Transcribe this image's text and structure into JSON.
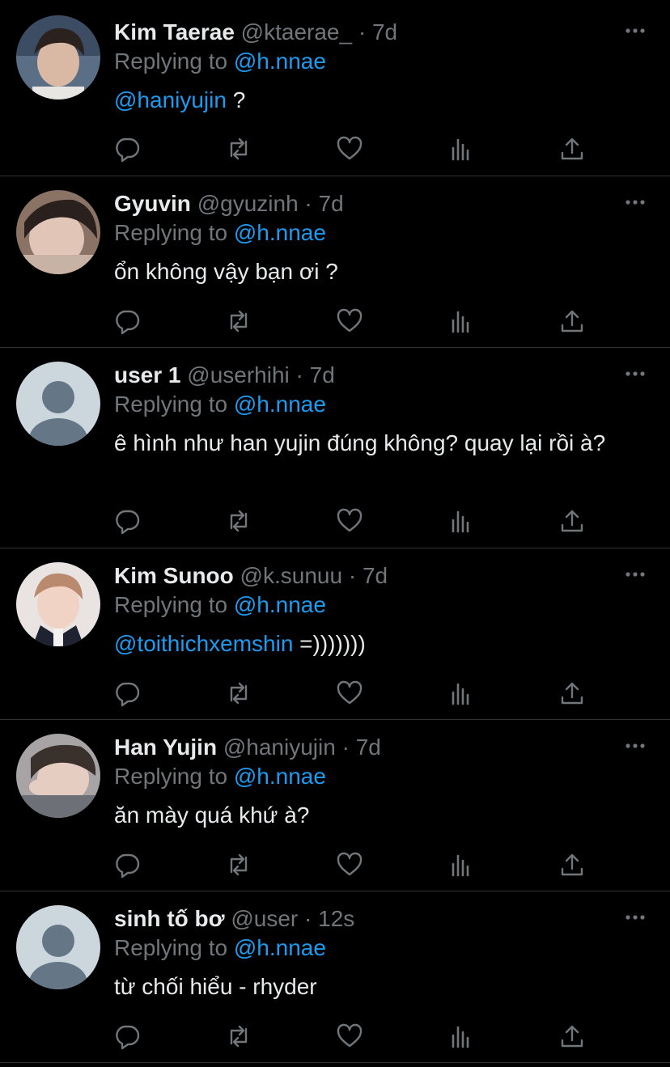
{
  "replies": [
    {
      "name": "Kim Taerae",
      "handle": "@ktaerae_",
      "dot": "·",
      "time": "7d",
      "replying_prefix": "Replying to",
      "replying_to": "@h.nnae",
      "body_mention": "@haniyujin",
      "body_text": " ?",
      "avatar": "photo"
    },
    {
      "name": "Gyuvin",
      "handle": "@gyuzinh",
      "dot": "·",
      "time": "7d",
      "replying_prefix": "Replying to",
      "replying_to": "@h.nnae",
      "body_mention": "",
      "body_text": "ổn không vậy bạn ơi ?",
      "avatar": "photo"
    },
    {
      "name": "user 1",
      "handle": "@userhihi",
      "dot": "·",
      "time": "7d",
      "replying_prefix": "Replying to",
      "replying_to": "@h.nnae",
      "body_mention": "",
      "body_text": "ê hình như han yujin đúng không? quay lại rồi à?",
      "avatar": "default"
    },
    {
      "name": "Kim Sunoo",
      "handle": "@k.sunuu",
      "dot": "·",
      "time": "7d",
      "replying_prefix": "Replying to",
      "replying_to": "@h.nnae",
      "body_mention": "@toithichxemshin",
      "body_text": " =)))))))",
      "avatar": "photo"
    },
    {
      "name": "Han Yujin",
      "handle": "@haniyujin",
      "dot": "·",
      "time": "7d",
      "replying_prefix": "Replying to",
      "replying_to": "@h.nnae",
      "body_mention": "",
      "body_text": "ăn mày quá khứ à?",
      "avatar": "photo"
    },
    {
      "name": "sinh tố bơ",
      "handle": "@user",
      "dot": "·",
      "time": "12s",
      "replying_prefix": "Replying to",
      "replying_to": "@h.nnae",
      "body_mention": "",
      "body_text": "từ chối hiểu - rhyder",
      "avatar": "default"
    }
  ],
  "actions": [
    "reply-icon",
    "retweet-icon",
    "like-icon",
    "analytics-icon",
    "share-icon"
  ],
  "colors": {
    "background": "#000000",
    "primary_text": "#e7e9ea",
    "secondary_text": "#71767b",
    "link": "#1d9bf0",
    "divider": "#2f3336"
  }
}
